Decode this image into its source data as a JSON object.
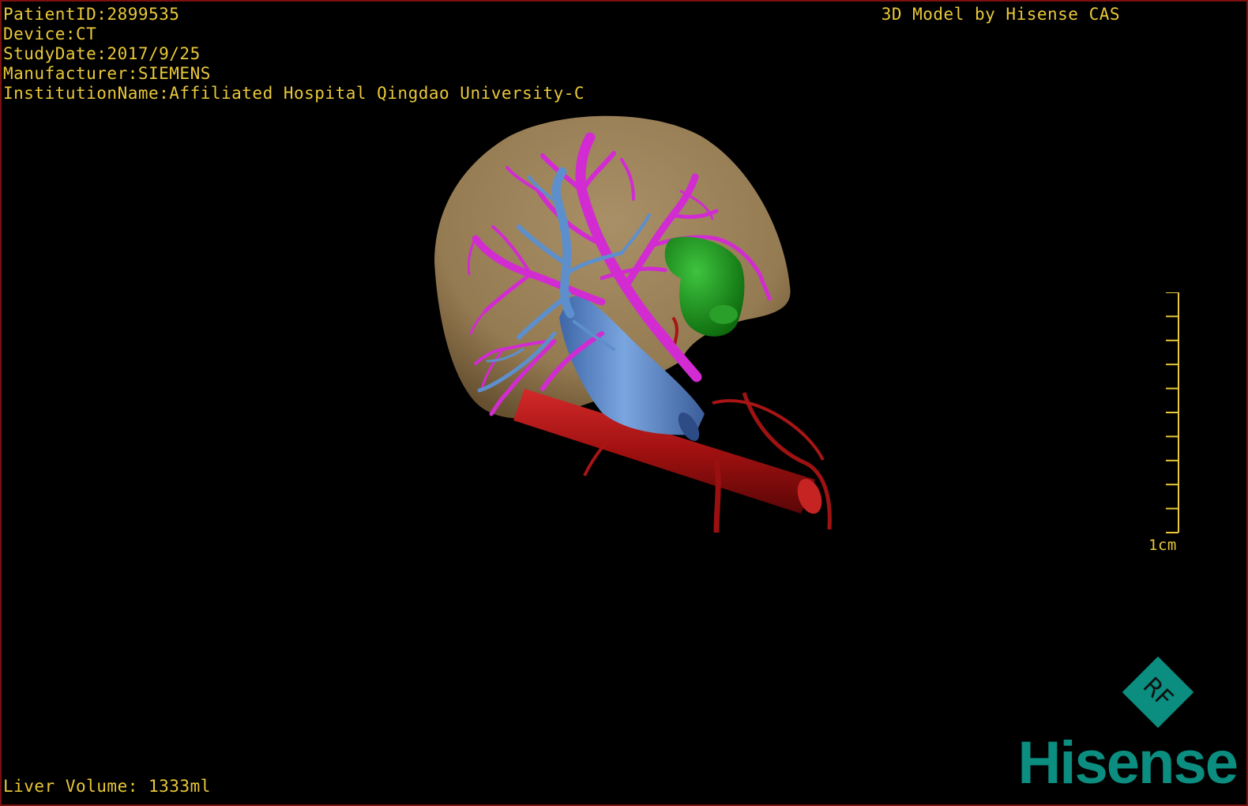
{
  "overlay": {
    "patient_id": "PatientID:2899535",
    "device": "Device:CT",
    "study_date": "StudyDate:2017/9/25",
    "manufacturer": "Manufacturer:SIEMENS",
    "institution": "InstitutionName:Affiliated Hospital Qingdao University-C"
  },
  "credit": "3D Model by Hisense CAS",
  "liver_volume": "Liver Volume: 1333ml",
  "scale": {
    "label": "1cm"
  },
  "logo": {
    "badge_text": "RF",
    "brand": "Hisense"
  },
  "colors": {
    "overlay_text": "#e9c83a",
    "liver": "#a58a60",
    "hepatic_vein": "#d22bd2",
    "portal_vein": "#5d8fcc",
    "vena_cava": "#5f86c4",
    "aorta": "#b01515",
    "lesion": "#1e9a1e",
    "brand": "#0b8d80",
    "frame_border": "#7a1010"
  },
  "icons": {
    "badge": "rf-diamond-icon"
  }
}
